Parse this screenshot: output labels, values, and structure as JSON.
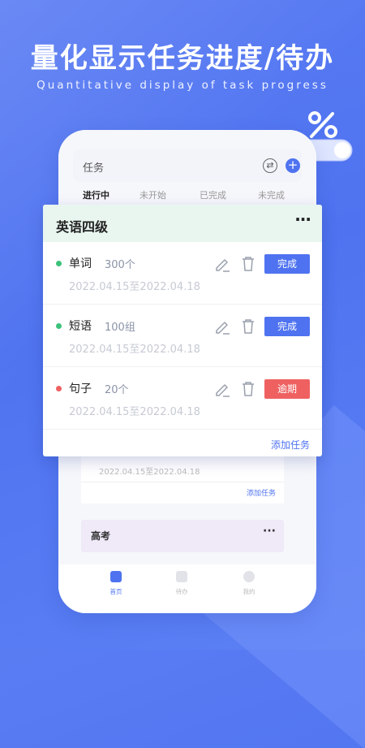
{
  "headline": "量化显示任务进度/待办",
  "subheadline": "Quantitative display of task progress",
  "phone": {
    "header_title": "任务",
    "tabs": [
      {
        "label": "进行中",
        "active": true
      },
      {
        "label": "未开始",
        "active": false
      },
      {
        "label": "已完成",
        "active": false
      },
      {
        "label": "未完成",
        "active": false
      }
    ],
    "bg_card": {
      "date": "2022.04.15至2022.04.18",
      "add_label": "添加任务"
    },
    "bg_group": {
      "title": "高考",
      "more": "···"
    },
    "nav": [
      {
        "label": "首页",
        "icon": "home-icon",
        "active": true
      },
      {
        "label": "待办",
        "icon": "todo-icon",
        "active": false
      },
      {
        "label": "我的",
        "icon": "profile-icon",
        "active": false
      }
    ]
  },
  "card": {
    "title": "英语四级",
    "more": "···",
    "tasks": [
      {
        "name": "单词",
        "count": "300个",
        "date": "2022.04.15至2022.04.18",
        "status_label": "完成",
        "status_color": "#4f73f0",
        "dot_color": "#3cc27a"
      },
      {
        "name": "短语",
        "count": "100组",
        "date": "2022.04.15至2022.04.18",
        "status_label": "完成",
        "status_color": "#4f73f0",
        "dot_color": "#3cc27a"
      },
      {
        "name": "句子",
        "count": "20个",
        "date": "2022.04.15至2022.04.18",
        "status_label": "逾期",
        "status_color": "#ef6161",
        "dot_color": "#ef6161"
      }
    ],
    "add_label": "添加任务"
  },
  "colors": {
    "accent": "#4f73f0",
    "overdue": "#ef6161",
    "done_dot": "#3cc27a"
  }
}
